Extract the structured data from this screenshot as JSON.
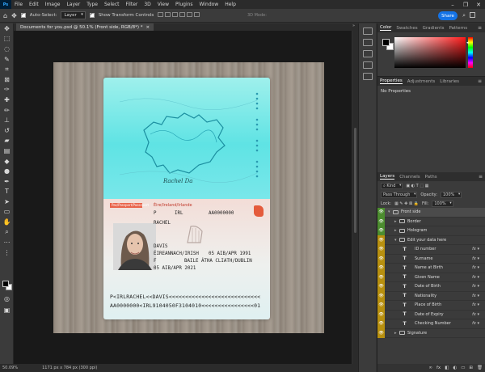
{
  "menubar": {
    "app_logo": "Ps",
    "items": [
      "File",
      "Edit",
      "Image",
      "Layer",
      "Type",
      "Select",
      "Filter",
      "3D",
      "View",
      "Plugins",
      "Window",
      "Help"
    ]
  },
  "options_bar": {
    "auto_select_label": "Auto-Select:",
    "auto_select_value": "Layer",
    "show_transform_label": "Show Transform Controls",
    "mode_3d_label": "3D Mode:",
    "share_label": "Share"
  },
  "document_tab": {
    "title": "Documents for you.psd @ 50.1% (Front side, RGB/8*) *",
    "close": "×"
  },
  "status_bar": {
    "zoom": "50.09%",
    "doc_info": "1171 px x 784 px (300 ppi)"
  },
  "passport": {
    "country_irish": "Éire/Ireland/Irlande",
    "country_ga": "Pas/Passport/Passeport",
    "type": "P",
    "code": "IRL",
    "number": "AA0000000",
    "surname": "RACHEL",
    "given": "DAVIS",
    "nationality": "ÉIREANNACH/IRISH",
    "dob": "05 AIB/APR 1991",
    "sex": "F",
    "pob": "BAILE ÁTHA CLIATH/DUBLIN",
    "doi": "05 AIB/APR 2021",
    "signature": "Rachel Da",
    "mrz_line1": "P<IRLRACHEL<<DAVIS<<<<<<<<<<<<<<<<<<<<<<<<<<<<",
    "mrz_line2": "AA0000000<IRL9104050F3104010<<<<<<<<<<<<<<<<01"
  },
  "panels": {
    "color_tabs": [
      "Color",
      "Swatches",
      "Gradients",
      "Patterns"
    ],
    "props_tabs": [
      "Properties",
      "Adjustments",
      "Libraries"
    ],
    "no_properties": "No Properties",
    "layers_tabs": [
      "Layers",
      "Channels",
      "Paths"
    ],
    "blend_mode": "Pass Through",
    "opacity_label": "Opacity:",
    "opacity_value": "100%",
    "lock_label": "Lock:",
    "fill_label": "Fill:",
    "fill_value": "100%"
  },
  "layers": [
    {
      "name": "Front side",
      "kind": "folder",
      "indent": 0,
      "eye": "green"
    },
    {
      "name": "Border",
      "kind": "folder",
      "indent": 1,
      "eye": "green"
    },
    {
      "name": "Hologram",
      "kind": "folder",
      "indent": 1,
      "eye": "green"
    },
    {
      "name": "Edit your data here",
      "kind": "folder",
      "indent": 1,
      "eye": "yellow"
    },
    {
      "name": "ID number",
      "kind": "text",
      "indent": 2,
      "eye": "yellow",
      "fx": true
    },
    {
      "name": "Surname",
      "kind": "text",
      "indent": 2,
      "eye": "yellow",
      "fx": true
    },
    {
      "name": "Name at Birth",
      "kind": "text",
      "indent": 2,
      "eye": "yellow",
      "fx": true
    },
    {
      "name": "Given Name",
      "kind": "text",
      "indent": 2,
      "eye": "yellow",
      "fx": true
    },
    {
      "name": "Date of Birth",
      "kind": "text",
      "indent": 2,
      "eye": "yellow",
      "fx": true
    },
    {
      "name": "Nationality",
      "kind": "text",
      "indent": 2,
      "eye": "yellow",
      "fx": true
    },
    {
      "name": "Place of Birth",
      "kind": "text",
      "indent": 2,
      "eye": "yellow",
      "fx": true
    },
    {
      "name": "Date of Expiry",
      "kind": "text",
      "indent": 2,
      "eye": "yellow",
      "fx": true
    },
    {
      "name": "Checking Number",
      "kind": "text",
      "indent": 2,
      "eye": "yellow",
      "fx": true
    },
    {
      "name": "Signature",
      "kind": "folder",
      "indent": 1,
      "eye": "yellow"
    }
  ]
}
